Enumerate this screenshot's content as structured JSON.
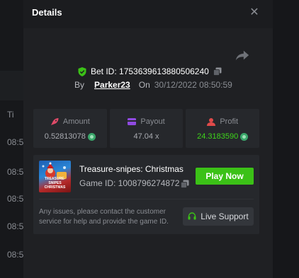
{
  "background": {
    "rows": [
      "Ti",
      "08:5",
      "08:5",
      "08:5",
      "08:5",
      "08:5",
      "08:5"
    ]
  },
  "modal": {
    "title": "Details",
    "close_icon": "close-icon"
  },
  "bet": {
    "id_text": "Bet ID: 1753639613880506240",
    "by_label": "By",
    "user": "Parker23",
    "on_label": "On",
    "date": "30/12/2022 08:50:59"
  },
  "stats": [
    {
      "label": "Amount",
      "value": "0.52813078",
      "icon": "rocket-icon",
      "icon_color": "#e04a68"
    },
    {
      "label": "Payout",
      "value": "47.04 x",
      "icon": "card-icon",
      "icon_color": "#8f4ae0"
    },
    {
      "label": "Profit",
      "value": "24.3183590",
      "icon": "user-icon",
      "icon_color": "#e04a4a",
      "value_color": "#3dd51a"
    }
  ],
  "game": {
    "thumb_text": "TREASURE-SNIPES CHRISTMAS",
    "name": "Treasure-snipes: Christmas",
    "id_text": "Game ID: 1008796274872",
    "play_label": "Play Now",
    "notice": "Any issues, please contact the customer service for help and provide the game ID.",
    "support_label": "Live Support"
  },
  "colors": {
    "accent_green": "#3bc117",
    "modal_bg": "#1f2023",
    "card_bg": "#26282c"
  }
}
